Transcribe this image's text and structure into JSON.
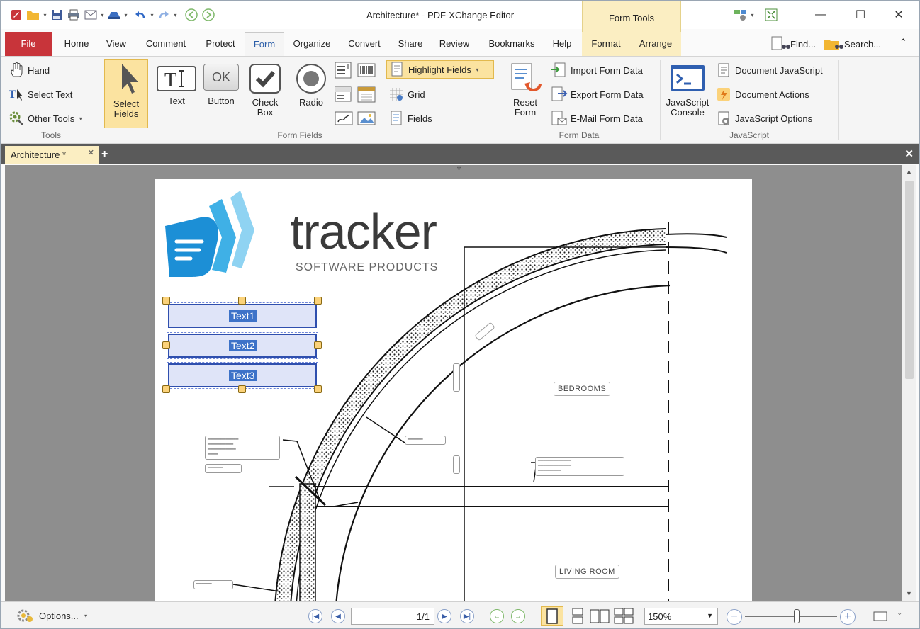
{
  "window": {
    "title": "Architecture* - PDF-XChange Editor",
    "context_tab": "Form Tools"
  },
  "menu": {
    "tabs": [
      "File",
      "Home",
      "View",
      "Comment",
      "Protect",
      "Form",
      "Organize",
      "Convert",
      "Share",
      "Review",
      "Bookmarks",
      "Help",
      "Format",
      "Arrange"
    ],
    "active": "Form"
  },
  "search": {
    "find_label": "Find...",
    "search_label": "Search..."
  },
  "ribbon": {
    "tools": {
      "hand": "Hand",
      "select_text": "Select Text",
      "other_tools": "Other Tools",
      "label": "Tools"
    },
    "form_fields": {
      "select_fields": "Select\nFields",
      "text": "Text",
      "button": "Button",
      "check_box": "Check\nBox",
      "radio": "Radio",
      "ok_icon_text": "OK",
      "highlight_fields": "Highlight Fields",
      "grid": "Grid",
      "fields": "Fields",
      "label": "Form Fields"
    },
    "form_data": {
      "reset_form": "Reset\nForm",
      "import": "Import Form Data",
      "export": "Export Form Data",
      "email": "E-Mail Form Data",
      "label": "Form Data"
    },
    "javascript": {
      "console": "JavaScript\nConsole",
      "document_js": "Document JavaScript",
      "document_actions": "Document Actions",
      "js_options": "JavaScript Options",
      "label": "JavaScript"
    }
  },
  "document_tab": {
    "name": "Architecture *"
  },
  "page": {
    "logo_main": "tracker",
    "logo_sub": "SOFTWARE PRODUCTS",
    "fields": [
      "Text1",
      "Text2",
      "Text3"
    ],
    "rooms": {
      "bedrooms": "BEDROOMS",
      "living_room": "LIVING ROOM"
    }
  },
  "statusbar": {
    "options_label": "Options...",
    "page_value": "1/1",
    "zoom_value": "150%"
  }
}
